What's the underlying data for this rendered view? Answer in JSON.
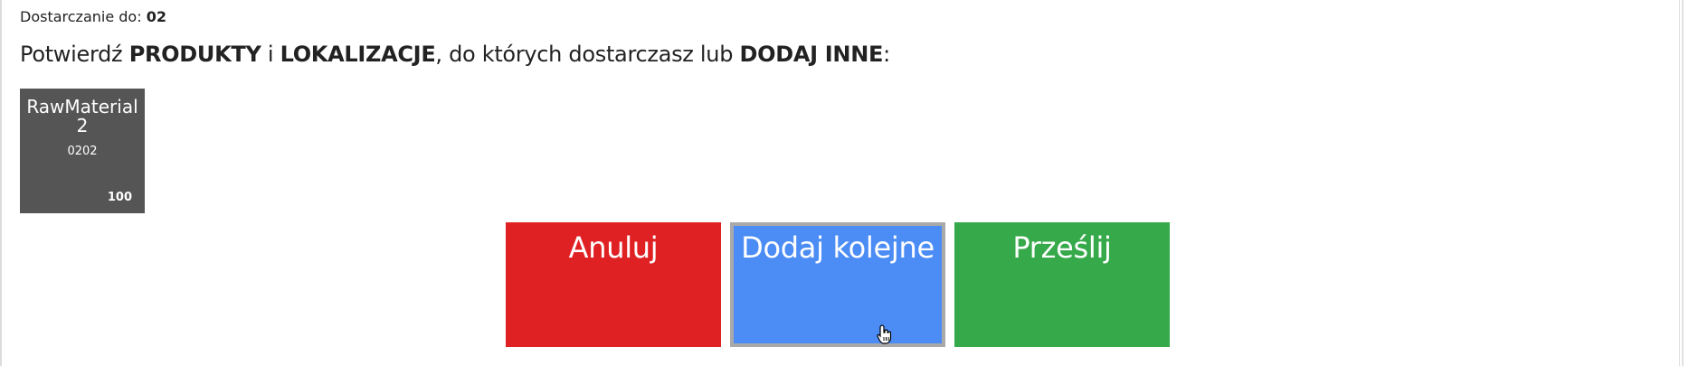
{
  "header": {
    "delivery_label": "Dostarczanie do:",
    "delivery_value": "02"
  },
  "instruction": {
    "part1": "Potwierdź ",
    "products": "PRODUKTY",
    "part2": " i ",
    "locations": "LOKALIZACJE",
    "part3": ", do których dostarczasz lub ",
    "add_other": "DODAJ INNE",
    "part4": ":"
  },
  "products": [
    {
      "name": "RawMaterial2",
      "code": "0202",
      "quantity": "100"
    }
  ],
  "buttons": {
    "cancel": "Anuluj",
    "add_next": "Dodaj kolejne",
    "send": "Prześlij"
  },
  "colors": {
    "cancel": "#e02124",
    "add_next": "#4b8cf5",
    "send": "#36a94a",
    "tile": "#555555"
  }
}
